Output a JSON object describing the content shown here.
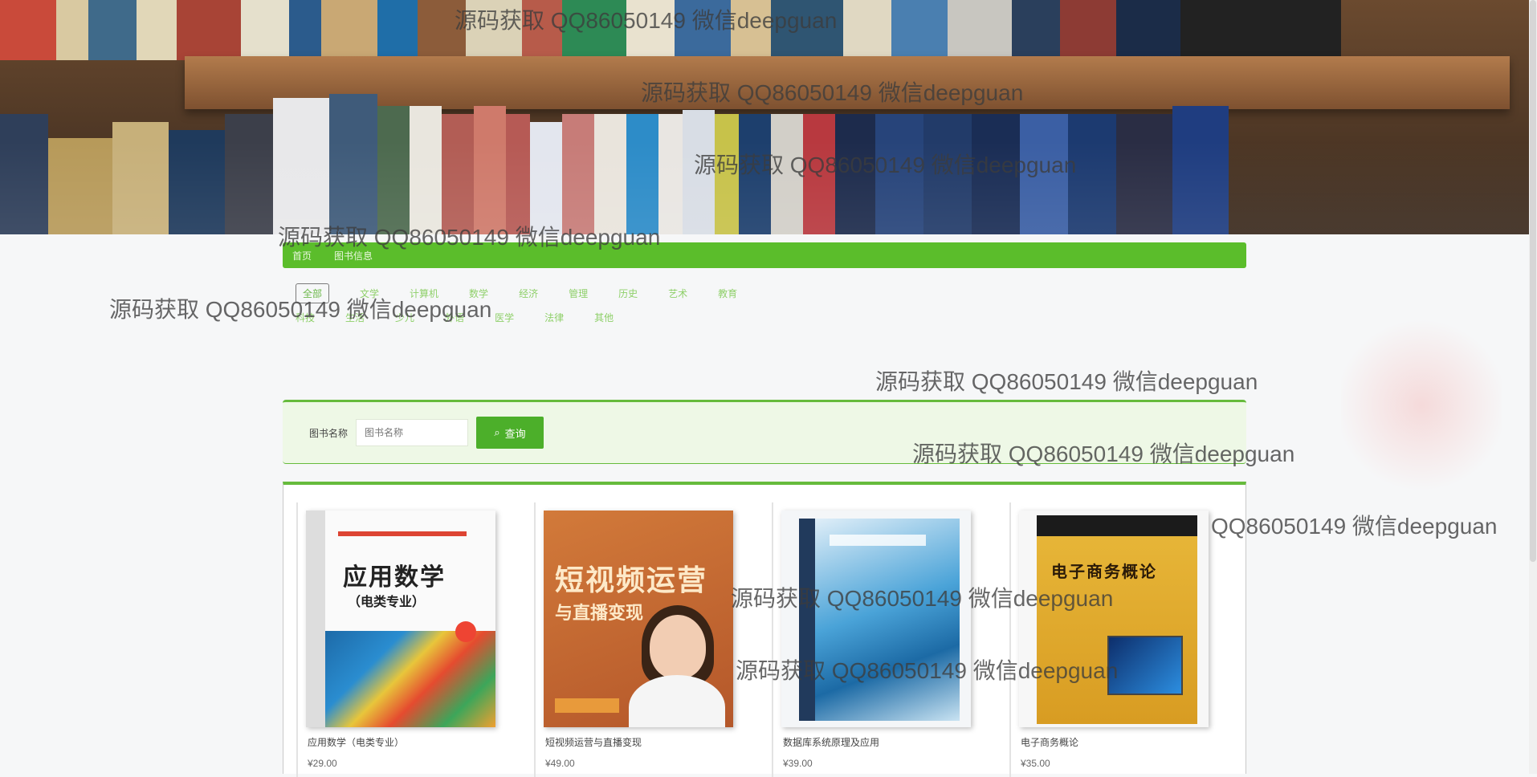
{
  "banner": {
    "alt": "bookshelf banner"
  },
  "nav": {
    "items": [
      "首页",
      "图书信息"
    ]
  },
  "filters": {
    "row1": [
      "全部",
      "文学",
      "计算机",
      "数学",
      "经济",
      "管理",
      "历史",
      "艺术",
      "教育"
    ],
    "row2": [
      "科技",
      "生活",
      "少儿",
      "外语",
      "医学",
      "法律",
      "其他"
    ],
    "selected": "全部"
  },
  "search": {
    "label": "图书名称",
    "placeholder": "图书名称",
    "button_label": "查询"
  },
  "books": [
    {
      "title": "应用数学（电类专业）",
      "price": "¥29.00",
      "cover_title": "应用数学",
      "cover_subtitle": "（电类专业）"
    },
    {
      "title": "短视频运营与直播变现",
      "price": "¥49.00",
      "cover_title": "短视频运营",
      "cover_subtitle": "与直播变现"
    },
    {
      "title": "数据库系统原理及应用",
      "price": "¥39.00",
      "cover_title": "",
      "cover_subtitle": ""
    },
    {
      "title": "电子商务概论",
      "price": "¥35.00",
      "cover_title": "电子商务概论",
      "cover_subtitle": ""
    }
  ],
  "watermark": "源码获取 QQ86050149 微信deepguan",
  "watermark_partial": "QQ86050149 微信deepguan",
  "colors": {
    "accent": "#5bbd2b",
    "panel": "#eef8e6",
    "button": "#4caf2a"
  }
}
